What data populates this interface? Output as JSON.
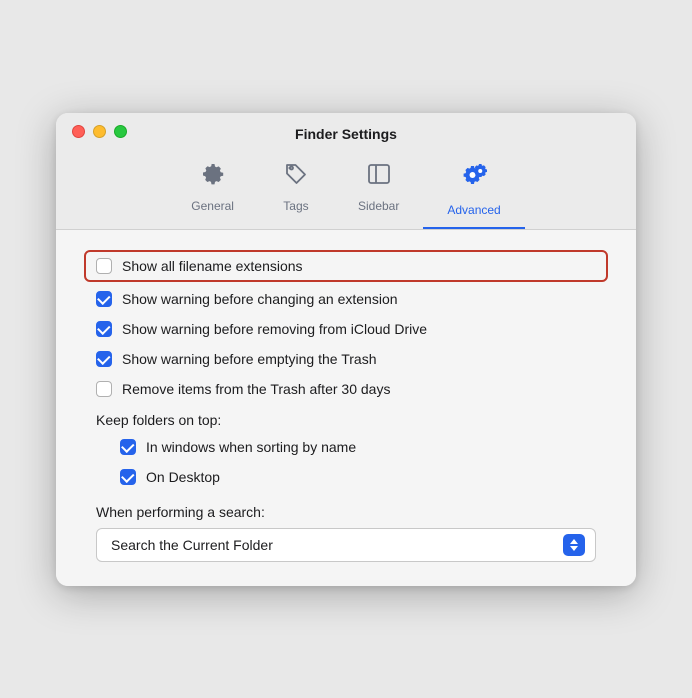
{
  "window": {
    "title": "Finder Settings"
  },
  "tabs": [
    {
      "id": "general",
      "label": "General",
      "icon": "gear"
    },
    {
      "id": "tags",
      "label": "Tags",
      "icon": "tag"
    },
    {
      "id": "sidebar",
      "label": "Sidebar",
      "icon": "sidebar"
    },
    {
      "id": "advanced",
      "label": "Advanced",
      "icon": "advanced-gear",
      "active": true
    }
  ],
  "options": [
    {
      "id": "show-extensions",
      "label": "Show all filename extensions",
      "checked": false,
      "highlighted": true
    },
    {
      "id": "warn-extension",
      "label": "Show warning before changing an extension",
      "checked": true
    },
    {
      "id": "warn-icloud",
      "label": "Show warning before removing from iCloud Drive",
      "checked": true
    },
    {
      "id": "warn-trash",
      "label": "Show warning before emptying the Trash",
      "checked": true
    },
    {
      "id": "remove-trash",
      "label": "Remove items from the Trash after 30 days",
      "checked": false
    }
  ],
  "keep_folders_label": "Keep folders on top:",
  "keep_folders_options": [
    {
      "id": "keep-windows",
      "label": "In windows when sorting by name",
      "checked": true
    },
    {
      "id": "keep-desktop",
      "label": "On Desktop",
      "checked": true
    }
  ],
  "search_label": "When performing a search:",
  "search_value": "Search the Current Folder",
  "traffic_lights": {
    "close": "Close",
    "minimize": "Minimize",
    "maximize": "Maximize"
  }
}
